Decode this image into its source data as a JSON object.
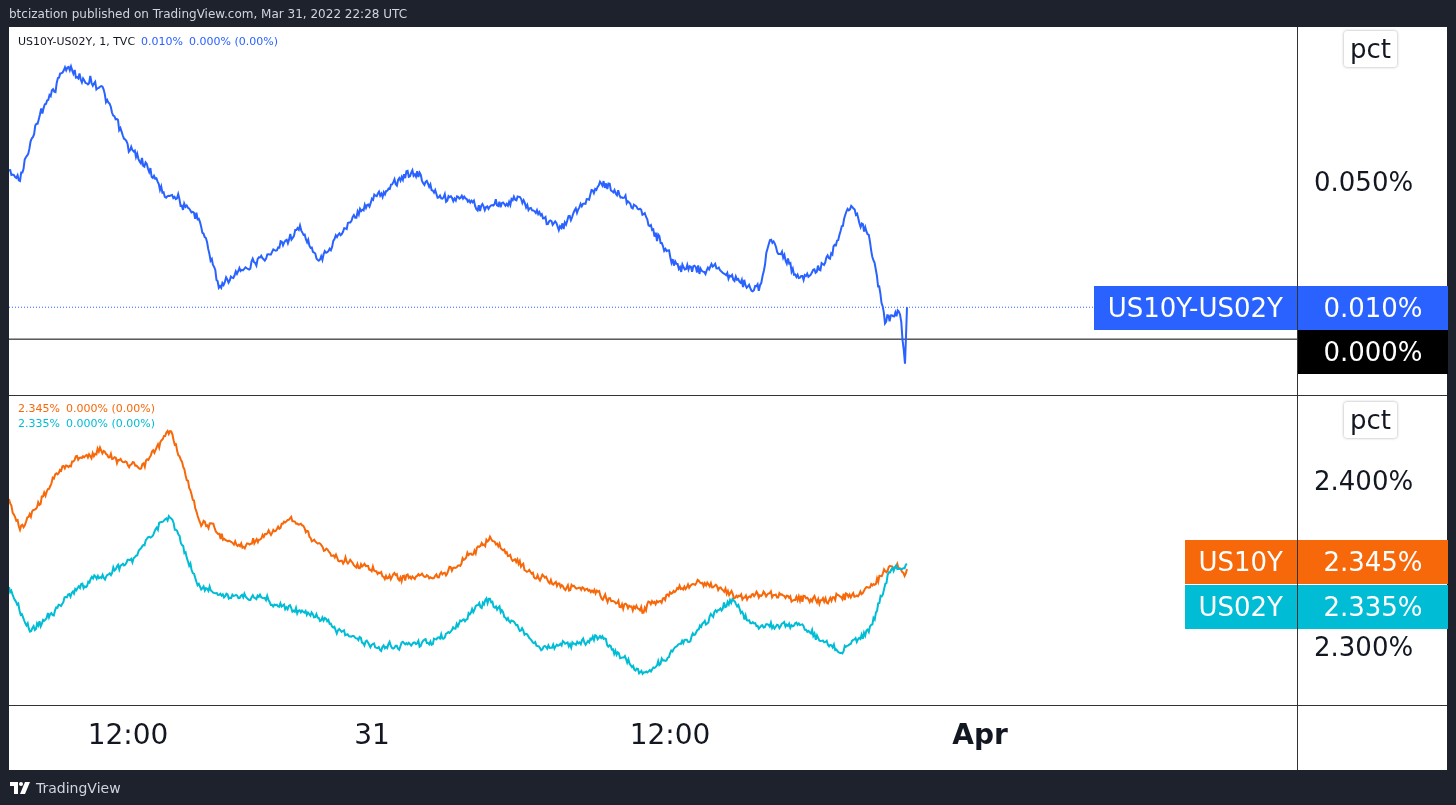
{
  "header": {
    "title": "btcization published on TradingView.com, Mar 31, 2022 22:28 UTC"
  },
  "top_pane": {
    "legend": {
      "symbol": "US10Y-US02Y, 1, TVC",
      "value": "0.010%",
      "change": "0.000% (0.00%)",
      "color": "#2962ff"
    },
    "scale_label": "pct",
    "ticks": [
      "0.050%"
    ],
    "series_labels": [
      {
        "name": "US10Y-US02Y",
        "value": "0.010%",
        "color": "#2962ff"
      }
    ],
    "zero_label": "0.000%"
  },
  "bottom_pane": {
    "legend": [
      {
        "value": "2.345%",
        "change": "0.000% (0.00%)",
        "color": "#f7680a"
      },
      {
        "value": "2.335%",
        "change": "0.000% (0.00%)",
        "color": "#00bcd4"
      }
    ],
    "scale_label": "pct",
    "ticks": [
      "2.400%",
      "2.300%"
    ],
    "series_labels": [
      {
        "name": "US10Y",
        "value": "2.345%",
        "color": "#f7680a"
      },
      {
        "name": "US02Y",
        "value": "2.335%",
        "color": "#00bcd4"
      }
    ]
  },
  "time_axis": [
    {
      "label": "12:00",
      "bold": false
    },
    {
      "label": "31",
      "bold": false
    },
    {
      "label": "12:00",
      "bold": false
    },
    {
      "label": "Apr",
      "bold": true
    }
  ],
  "footer": {
    "brand": "TradingView"
  }
}
